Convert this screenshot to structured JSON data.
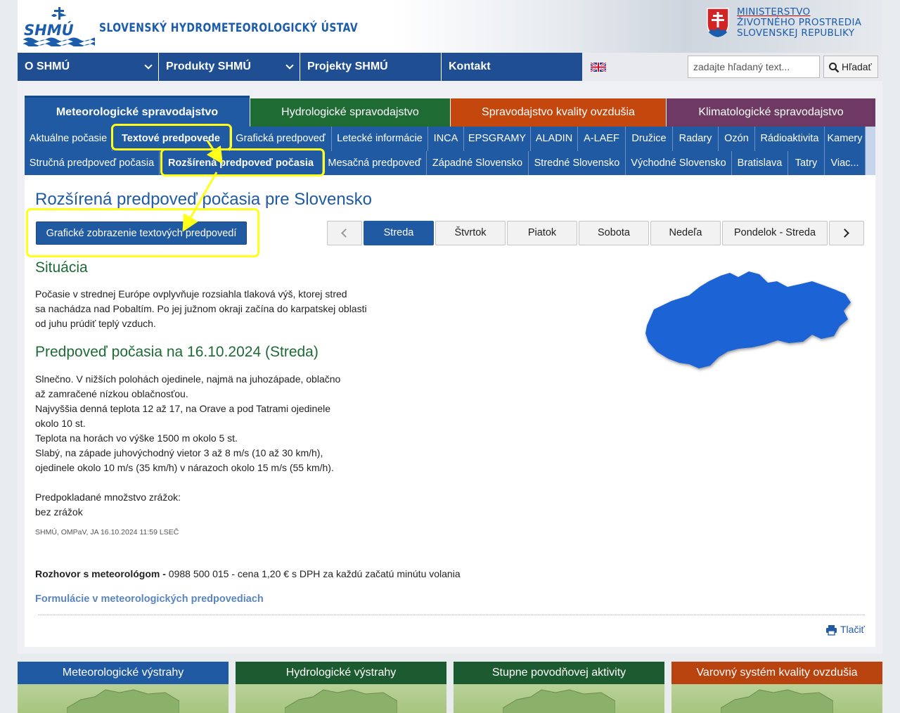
{
  "header": {
    "site_title": "SLOVENSKÝ HYDROMETEOROLOGICKÝ ÚSTAV",
    "logo_text": "SHMÚ",
    "ministry_line1": "MINISTERSTVO",
    "ministry_line2": "ŽIVOTNÉHO PROSTREDIA",
    "ministry_line3": "SLOVENSKEJ REPUBLIKY"
  },
  "main_nav": {
    "items": [
      "O SHMÚ",
      "Produkty SHMÚ",
      "Projekty SHMÚ",
      "Kontakt"
    ],
    "search_placeholder": "zadajte hľadaný text...",
    "search_button": "Hľadať"
  },
  "category_tabs": [
    "Meteorologické spravodajstvo",
    "Hydrologické spravodajstvo",
    "Spravodajstvo kvality ovzdušia",
    "Klimatologické spravodajstvo"
  ],
  "subnav1": [
    "Aktuálne počasie",
    "Textové predpovede",
    "Grafická predpoveď",
    "Letecké informácie",
    "INCA",
    "EPSGRAMY",
    "ALADIN",
    "A-LAEF",
    "Družice",
    "Radary",
    "Ozón",
    "Rádioaktivita",
    "Kamery"
  ],
  "subnav2": [
    "Stručná predpoveď počasia",
    "Rozšírená predpoveď počasia",
    "Mesačná predpoveď",
    "Západné Slovensko",
    "Stredné Slovensko",
    "Východné Slovensko",
    "Bratislava",
    "Tatry",
    "Viac..."
  ],
  "page": {
    "title": "Rozšírená predpoveď počasia pre Slovensko",
    "graph_button": "Grafické zobrazenie textových predpovedí",
    "days": [
      "Streda",
      "Štvrtok",
      "Piatok",
      "Sobota",
      "Nedeľa",
      "Pondelok - Streda"
    ],
    "situation_heading": "Situácia",
    "situation_lines": [
      "Počasie v strednej Európe ovplyvňuje rozsiahla tlaková výš, ktorej stred",
      "sa nachádza nad Pobaltím. Po jej južnom okraji začína do karpatskej oblasti",
      "od juhu prúdiť teplý vzduch."
    ],
    "forecast_heading": "Predpoveď počasia na 16.10.2024 (Streda)",
    "forecast_lines": [
      "Slnečno. V nižších polohách ojedinele, najmä na juhozápade, oblačno",
      "až zamračené nízkou oblačnosťou.",
      "Najvyššia denná teplota 12 až 17, na Orave a pod Tatrami ojedinele",
      "okolo 10 st.",
      "Teplota na horách vo výške 1500 m okolo 5 st.",
      "Slabý, na západe juhovýchodný vietor 3 až 8 m/s (10 až 30 km/h),",
      "ojedinele okolo 10 m/s (35 km/h) v nárazoch okolo 15 m/s (55 km/h)."
    ],
    "precip_lines": [
      "Predpokladané množstvo zrážok:",
      "bez zrážok"
    ],
    "author": "SHMÚ, OMPaV, JA 16.10.2024 11:59 LSEČ",
    "hotline_label": "Rozhovor s meteorológom -",
    "hotline_text": " 0988 500 015 - cena 1,20 € s DPH za každú začatú minútu volania",
    "formulations_link": "Formulácie v meteorologických predpovediach",
    "print": "Tlačiť"
  },
  "bottom_boxes": [
    "Meteorologické výstrahy",
    "Hydrologické výstrahy",
    "Stupne povodňovej aktivity",
    "Varovný systém kvality ovzdušia"
  ],
  "colors": {
    "brand_blue": "#1f5aa3",
    "hydro_green": "#1f6b34",
    "air_orange": "#c4470d",
    "climate_purple": "#6e3a63",
    "highlight_yellow": "#ffff1a"
  },
  "icons": [
    "shmu-logo-icon",
    "ministry-crest-icon",
    "uk-flag-icon",
    "search-icon",
    "chevron-down-icon",
    "chevron-left-icon",
    "chevron-right-icon",
    "printer-icon",
    "slovakia-map-icon"
  ]
}
